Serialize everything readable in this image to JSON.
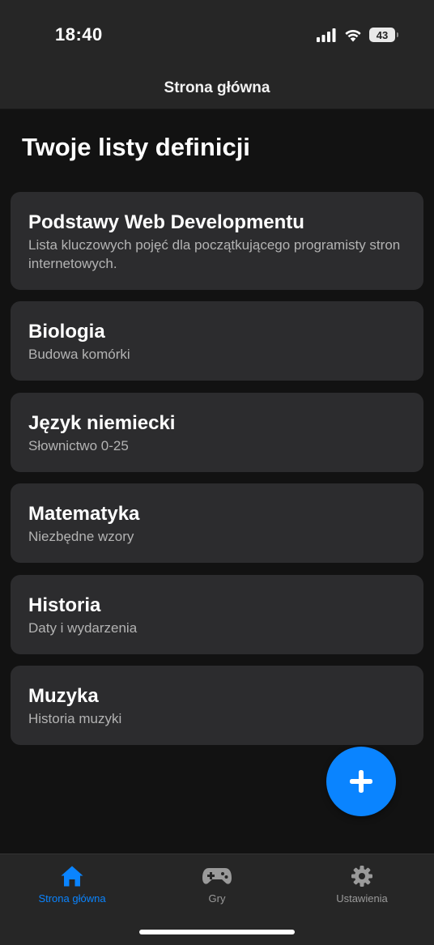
{
  "status_bar": {
    "time": "18:40",
    "battery": "43",
    "icons": [
      "cellular-signal-icon",
      "wifi-icon",
      "battery-icon"
    ]
  },
  "nav": {
    "title": "Strona główna"
  },
  "page": {
    "heading": "Twoje listy definicji"
  },
  "lists": [
    {
      "title": "Podstawy Web Developmentu",
      "subtitle": "Lista kluczowych pojęć dla początkującego programisty stron internetowych."
    },
    {
      "title": "Biologia",
      "subtitle": "Budowa komórki"
    },
    {
      "title": "Język niemiecki",
      "subtitle": "Słownictwo 0-25"
    },
    {
      "title": "Matematyka",
      "subtitle": "Niezbędne wzory"
    },
    {
      "title": "Historia",
      "subtitle": "Daty i wydarzenia"
    },
    {
      "title": "Muzyka",
      "subtitle": "Historia muzyki"
    }
  ],
  "fab": {
    "icon": "plus-icon"
  },
  "tabs": [
    {
      "label": "Strona główna",
      "icon": "home-icon",
      "active": true
    },
    {
      "label": "Gry",
      "icon": "gamepad-icon",
      "active": false
    },
    {
      "label": "Ustawienia",
      "icon": "gear-icon",
      "active": false
    }
  ],
  "colors": {
    "accent": "#0a84ff",
    "background": "#121212",
    "card": "#2c2c2e",
    "bar": "#262626",
    "subtitle": "#b3b3b3",
    "inactive_tab": "#9a9a9a"
  }
}
